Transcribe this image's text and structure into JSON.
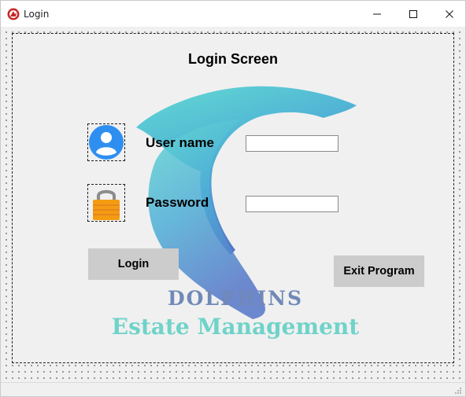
{
  "window": {
    "title": "Login",
    "controls": {
      "minimize_icon": "minimize-icon",
      "maximize_icon": "maximize-icon",
      "close_icon": "close-icon"
    }
  },
  "form": {
    "heading": "Login Screen",
    "username_label": "User name",
    "password_label": "Password",
    "username_value": "",
    "password_value": "",
    "login_button": "Login",
    "exit_button": "Exit Program"
  },
  "branding": {
    "line1": "DOLPHINS",
    "line2": "Estate Management"
  },
  "colors": {
    "dolphin_top": "#5fd3cf",
    "dolphin_bottom": "#5575c8",
    "brand_line1": "#7089b8",
    "brand_line2": "#6fd3c9",
    "button_bg": "#cccccc",
    "user_icon": "#2f8ff0",
    "lock_icon": "#f39c12"
  },
  "icons": [
    "app-icon",
    "user-icon",
    "lock-icon",
    "dolphin-logo"
  ]
}
